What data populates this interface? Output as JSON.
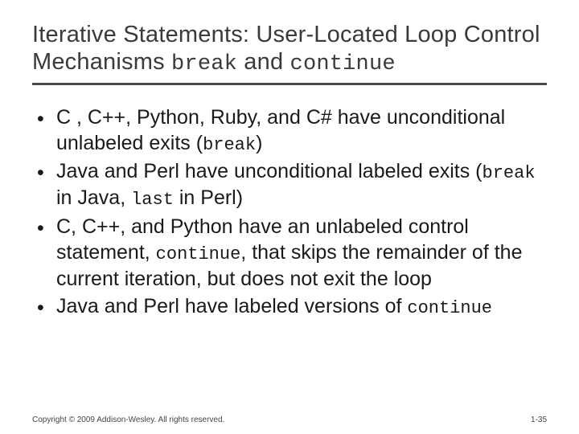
{
  "title": {
    "prefix": "Iterative Statements: User-Located Loop Control Mechanisms ",
    "code1": "break",
    "mid": " and ",
    "code2": "continue"
  },
  "bullets": [
    {
      "segments": [
        {
          "t": "C , C++, Python, Ruby, and C# have unconditional unlabeled exits ("
        },
        {
          "t": "break",
          "mono": true
        },
        {
          "t": ")"
        }
      ]
    },
    {
      "segments": [
        {
          "t": "Java and Perl have unconditional labeled exits ("
        },
        {
          "t": "break",
          "mono": true
        },
        {
          "t": " in Java, "
        },
        {
          "t": "last",
          "mono": true
        },
        {
          "t": " in Perl)"
        }
      ]
    },
    {
      "segments": [
        {
          "t": "C, C++, and Python have an unlabeled control statement, "
        },
        {
          "t": "continue",
          "mono": true
        },
        {
          "t": ", that skips the remainder of the current iteration, but does not exit the loop"
        }
      ]
    },
    {
      "segments": [
        {
          "t": "Java and Perl have labeled versions of "
        },
        {
          "t": "continue",
          "mono": true
        }
      ]
    }
  ],
  "footer": {
    "copyright": "Copyright © 2009 Addison-Wesley. All rights reserved.",
    "page": "1-35"
  }
}
